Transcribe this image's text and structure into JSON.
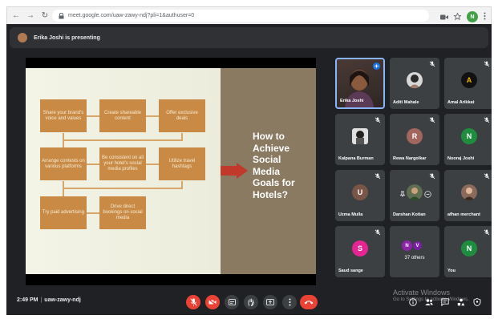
{
  "browser": {
    "url": "meet.google.com/uaw-zawy-ndj?pli=1&authuser=0",
    "profile_initial": "N"
  },
  "presenting": {
    "text": "Erika Joshi is presenting"
  },
  "slide": {
    "title": "How to\nAchieve\nSocial\nMedia\nGoals for\nHotels?",
    "boxes": [
      "Share your brand's voice and values",
      "Create shareable content",
      "Offer exclusive deals",
      "Arrange contests on various platforms",
      "Be consistent on all your hotel's social media profiles",
      "Utilize travel hashtags",
      "Try paid advertising",
      "Drive direct bookings on social media"
    ]
  },
  "participants": [
    {
      "name": "Erika Joshi",
      "type": "video"
    },
    {
      "name": "Aditi Mahale",
      "avatar_color": "#d8d8d8",
      "initial": ""
    },
    {
      "name": "Amal Arikkat",
      "avatar_color": "#111111",
      "initial": "A"
    },
    {
      "name": "Kalpana Burman",
      "avatar_color": "#e0e0e0",
      "initial": ""
    },
    {
      "name": "Rewa Nargolkar",
      "avatar_color": "#a1665e",
      "initial": "R"
    },
    {
      "name": "Nooraj Joshi",
      "avatar_color": "#1e8e3e",
      "initial": "N"
    },
    {
      "name": "Uzma Mulla",
      "avatar_color": "#795548",
      "initial": "U"
    },
    {
      "name": "Darshan Kotian",
      "avatar_color": "#5f6d52",
      "initial": ""
    },
    {
      "name": "afhan merchant",
      "avatar_color": "#8a6a5a",
      "initial": ""
    },
    {
      "name": "Saud sange",
      "avatar_color": "#e52592",
      "initial": "S"
    },
    {
      "name": "37 others",
      "avatar_color": "#8e24aa",
      "initial": "N"
    },
    {
      "name": "You",
      "avatar_color": "#1e8e3e",
      "initial": "N"
    }
  ],
  "others": {
    "initial_2": "V",
    "initial_2_color": "#7b1fa2"
  },
  "bottom": {
    "time": "2:49 PM",
    "meeting_code": "uaw-zawy-ndj"
  },
  "watermark": {
    "title": "Activate Windows",
    "subtitle": "Go to Settings to activate Windows."
  },
  "colors": {
    "accent": "#8ab4f8",
    "danger": "#ea4335",
    "slide_box": "#c88a44",
    "slide_arrow": "#c0392b"
  }
}
